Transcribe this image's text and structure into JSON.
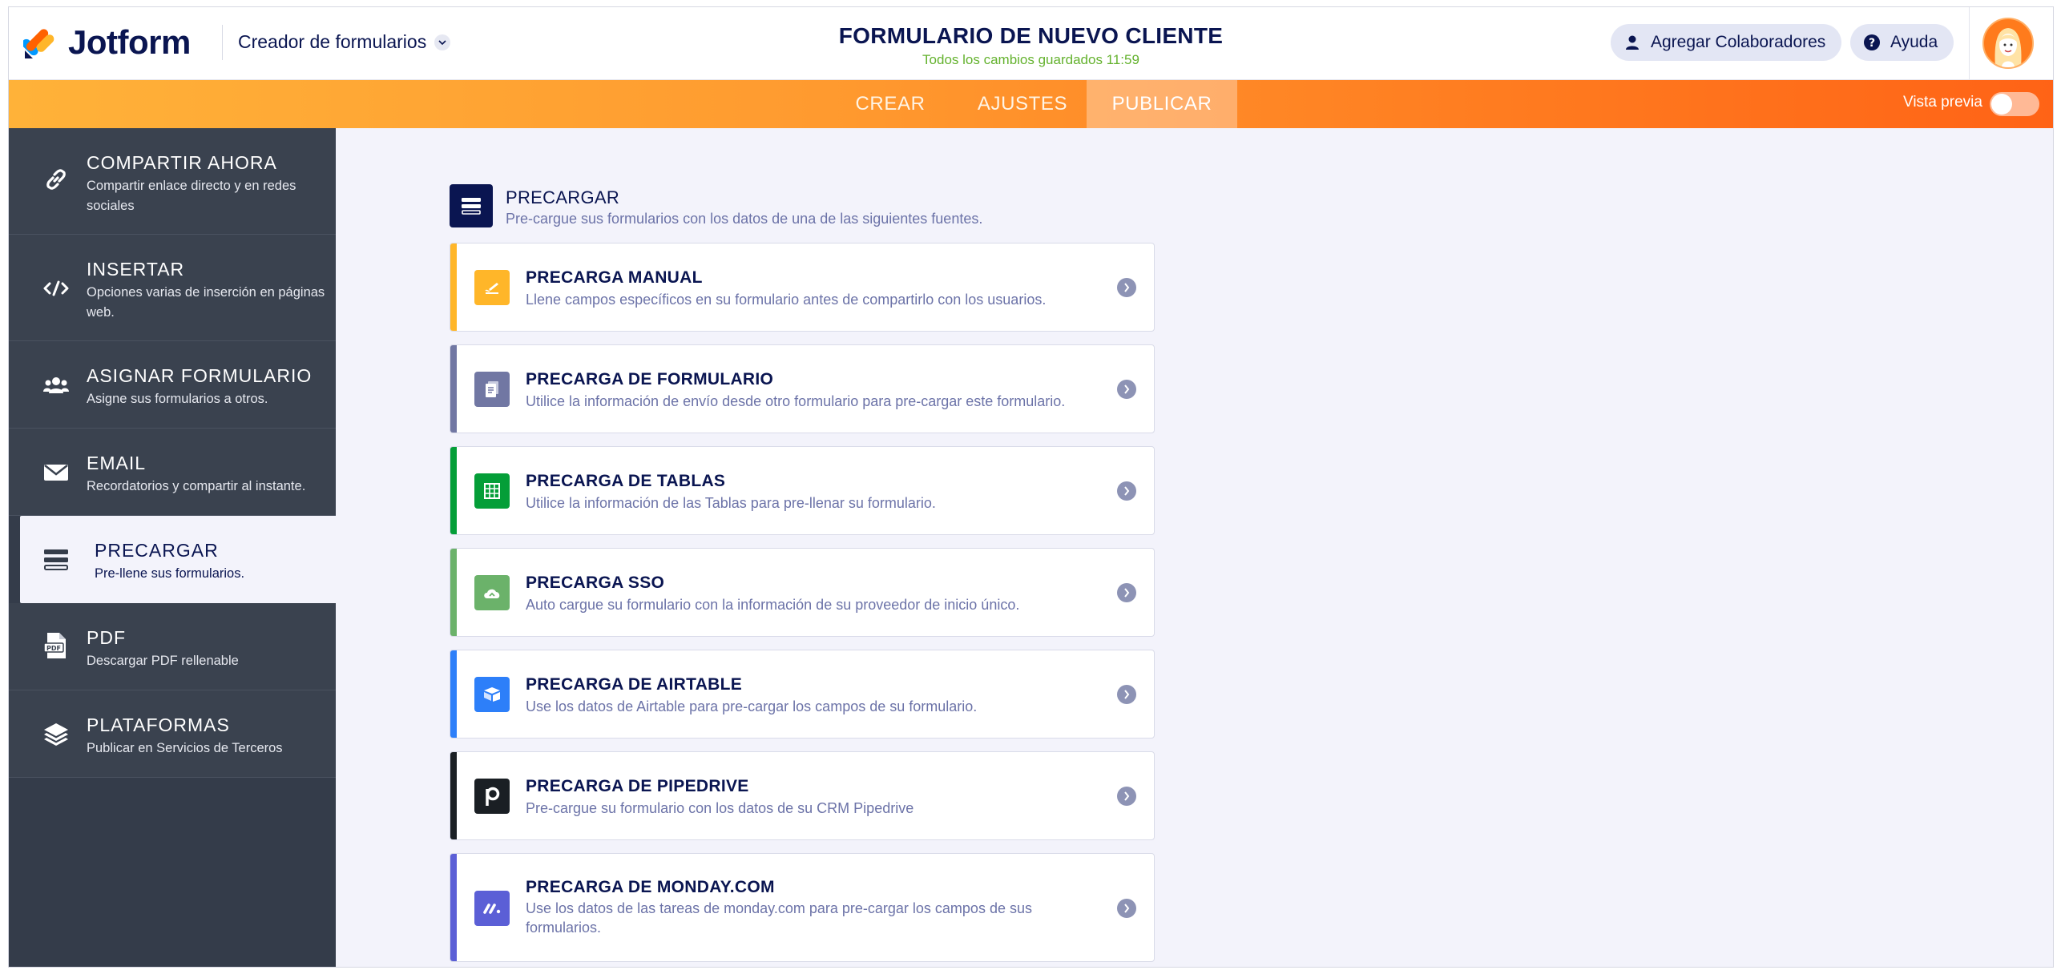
{
  "header": {
    "logo_text": "Jotform",
    "creator_label": "Creador de formularios",
    "form_title": "FORMULARIO DE NUEVO CLIENTE",
    "saved_status": "Todos los cambios guardados 11:59",
    "collab_label": "Agregar Colaboradores",
    "help_label": "Ayuda"
  },
  "nav": {
    "tabs": [
      {
        "label": "CREAR"
      },
      {
        "label": "AJUSTES"
      },
      {
        "label": "PUBLICAR",
        "active": true
      }
    ],
    "preview_label": "Vista previa",
    "preview_on": false
  },
  "sidebar": {
    "items": [
      {
        "title": "COMPARTIR AHORA",
        "desc": "Compartir enlace directo y en redes sociales",
        "icon": "link-icon"
      },
      {
        "title": "INSERTAR",
        "desc": "Opciones varias de inserción en páginas web.",
        "icon": "code-icon"
      },
      {
        "title": "ASIGNAR FORMULARIO",
        "desc": "Asigne sus formularios a otros.",
        "icon": "users-icon"
      },
      {
        "title": "EMAIL",
        "desc": "Recordatorios y compartir al instante.",
        "icon": "envelope-icon"
      },
      {
        "title": "PRECARGAR",
        "desc": "Pre-llene sus formularios.",
        "icon": "prefill-icon",
        "active": true
      },
      {
        "title": "PDF",
        "desc": "Descargar PDF rellenable",
        "icon": "pdf-icon"
      },
      {
        "title": "PLATAFORMAS",
        "desc": "Publicar en Servicios de Terceros",
        "icon": "layers-icon"
      }
    ]
  },
  "main": {
    "section_title": "PRECARGAR",
    "section_desc": "Pre-cargue sus formularios con los datos de una de las siguientes fuentes.",
    "cards": [
      {
        "title": "PRECARGA MANUAL",
        "desc": "Llene campos específicos en su formulario antes de compartirlo con los usuarios.",
        "color": "#ffb629",
        "icon": "pen-icon"
      },
      {
        "title": "PRECARGA DE FORMULARIO",
        "desc": "Utilice la información de envío desde otro formulario para pre-cargar este formulario.",
        "color": "#7177a3",
        "icon": "form-icon"
      },
      {
        "title": "PRECARGA DE TABLAS",
        "desc": "Utilice la información de las Tablas para pre-llenar su formulario.",
        "color": "#049e38",
        "icon": "table-icon"
      },
      {
        "title": "PRECARGA SSO",
        "desc": "Auto cargue su formulario con la información de su proveedor de inicio único.",
        "color": "#6bb26a",
        "icon": "cloud-icon"
      },
      {
        "title": "PRECARGA DE AIRTABLE",
        "desc": "Use los datos de Airtable para pre-cargar los campos de su formulario.",
        "color": "#2d7ff9",
        "icon": "airtable-icon"
      },
      {
        "title": "PRECARGA DE PIPEDRIVE",
        "desc": "Pre-cargue su formulario con los datos de su CRM Pipedrive",
        "color": "#1a1f24",
        "icon": "pipedrive-icon"
      },
      {
        "title": "PRECARGA DE MONDAY.COM",
        "desc": "Use los datos de las tareas de monday.com para pre-cargar los campos de sus formularios.",
        "color": "#5b5fd6",
        "icon": "monday-icon"
      }
    ]
  }
}
